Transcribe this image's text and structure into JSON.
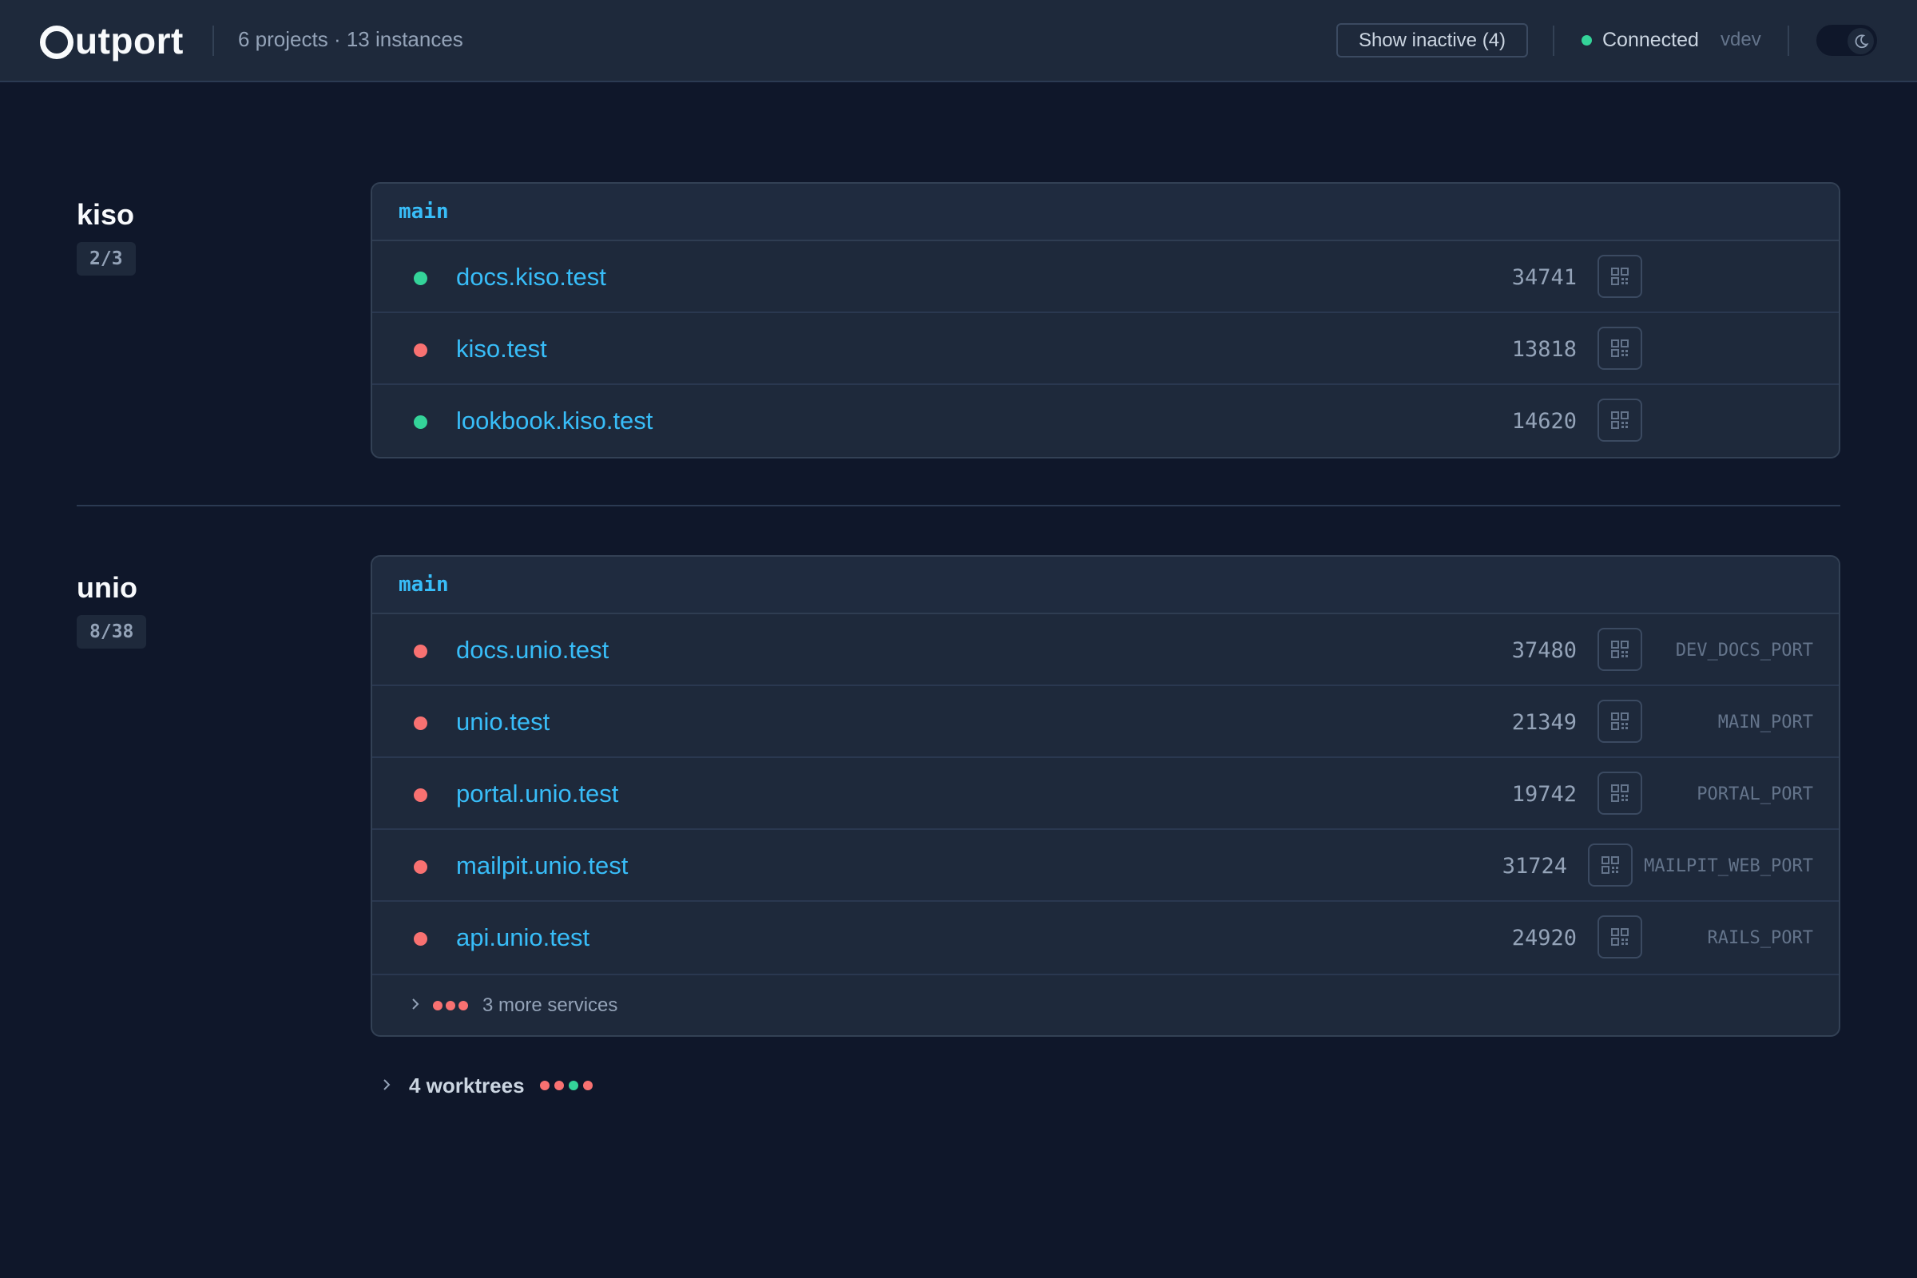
{
  "header": {
    "logo_rest": "utport",
    "summary": "6 projects · 13 instances",
    "show_inactive_label": "Show inactive (4)",
    "connection_status": "Connected",
    "environment": "vdev"
  },
  "colors": {
    "running": "#34d399",
    "stopped": "#f87171",
    "accent": "#38bdf8"
  },
  "projects": [
    {
      "name": "kiso",
      "badge": "2/3",
      "worktree": "main",
      "services": [
        {
          "name": "docs.kiso.test",
          "port": "34741",
          "status": "running",
          "env": ""
        },
        {
          "name": "kiso.test",
          "port": "13818",
          "status": "stopped",
          "env": ""
        },
        {
          "name": "lookbook.kiso.test",
          "port": "14620",
          "status": "running",
          "env": ""
        }
      ]
    },
    {
      "name": "unio",
      "badge": "8/38",
      "worktree": "main",
      "services": [
        {
          "name": "docs.unio.test",
          "port": "37480",
          "status": "stopped",
          "env": "DEV_DOCS_PORT"
        },
        {
          "name": "unio.test",
          "port": "21349",
          "status": "stopped",
          "env": "MAIN_PORT"
        },
        {
          "name": "portal.unio.test",
          "port": "19742",
          "status": "stopped",
          "env": "PORTAL_PORT"
        },
        {
          "name": "mailpit.unio.test",
          "port": "31724",
          "status": "stopped",
          "env": "MAILPIT_WEB_PORT"
        },
        {
          "name": "api.unio.test",
          "port": "24920",
          "status": "stopped",
          "env": "RAILS_PORT"
        }
      ],
      "more_services_label": "3 more services",
      "worktrees_label": "4 worktrees",
      "worktree_dots": [
        "stopped",
        "stopped",
        "running",
        "stopped"
      ]
    }
  ]
}
